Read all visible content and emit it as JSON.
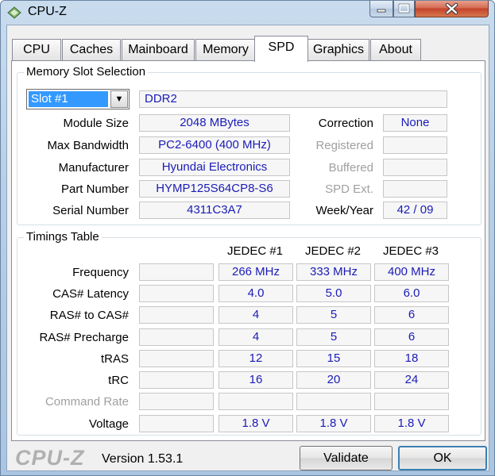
{
  "window": {
    "title": "CPU-Z"
  },
  "tabs": [
    {
      "label": "CPU",
      "active": false
    },
    {
      "label": "Caches",
      "active": false
    },
    {
      "label": "Mainboard",
      "active": false
    },
    {
      "label": "Memory",
      "active": false
    },
    {
      "label": "SPD",
      "active": true
    },
    {
      "label": "Graphics",
      "active": false
    },
    {
      "label": "About",
      "active": false
    }
  ],
  "slot_section": {
    "title": "Memory Slot Selection",
    "selected_slot": "Slot #1",
    "memory_type": "DDR2",
    "module_size_label": "Module Size",
    "module_size": "2048 MBytes",
    "max_bandwidth_label": "Max Bandwidth",
    "max_bandwidth": "PC2-6400 (400 MHz)",
    "manufacturer_label": "Manufacturer",
    "manufacturer": "Hyundai Electronics",
    "part_number_label": "Part Number",
    "part_number": "HYMP125S64CP8-S6",
    "serial_number_label": "Serial Number",
    "serial_number": "4311C3A7",
    "correction_label": "Correction",
    "correction": "None",
    "registered_label": "Registered",
    "registered": "",
    "buffered_label": "Buffered",
    "buffered": "",
    "spd_ext_label": "SPD Ext.",
    "spd_ext": "",
    "week_year_label": "Week/Year",
    "week_year": "42 / 09"
  },
  "timings": {
    "title": "Timings Table",
    "columns": [
      "JEDEC #1",
      "JEDEC #2",
      "JEDEC #3"
    ],
    "rows": [
      {
        "label": "Frequency",
        "values": [
          "266 MHz",
          "333 MHz",
          "400 MHz"
        ],
        "disabled": false
      },
      {
        "label": "CAS# Latency",
        "values": [
          "4.0",
          "5.0",
          "6.0"
        ],
        "disabled": false
      },
      {
        "label": "RAS# to CAS#",
        "values": [
          "4",
          "5",
          "6"
        ],
        "disabled": false
      },
      {
        "label": "RAS# Precharge",
        "values": [
          "4",
          "5",
          "6"
        ],
        "disabled": false
      },
      {
        "label": "tRAS",
        "values": [
          "12",
          "15",
          "18"
        ],
        "disabled": false
      },
      {
        "label": "tRC",
        "values": [
          "16",
          "20",
          "24"
        ],
        "disabled": false
      },
      {
        "label": "Command Rate",
        "values": [
          "",
          "",
          ""
        ],
        "disabled": true
      },
      {
        "label": "Voltage",
        "values": [
          "1.8 V",
          "1.8 V",
          "1.8 V"
        ],
        "disabled": false
      }
    ]
  },
  "footer": {
    "brand": "CPU-Z",
    "version": "Version 1.53.1",
    "validate_label": "Validate",
    "ok_label": "OK"
  },
  "colors": {
    "value_text": "#1b1bb8",
    "selection": "#3399ff",
    "close_button": "#c4432a"
  },
  "icons": {
    "app": "cpu-chip-icon",
    "minimize": "minimize-icon",
    "maximize": "maximize-icon",
    "close": "close-icon",
    "dropdown": "chevron-down-icon"
  }
}
